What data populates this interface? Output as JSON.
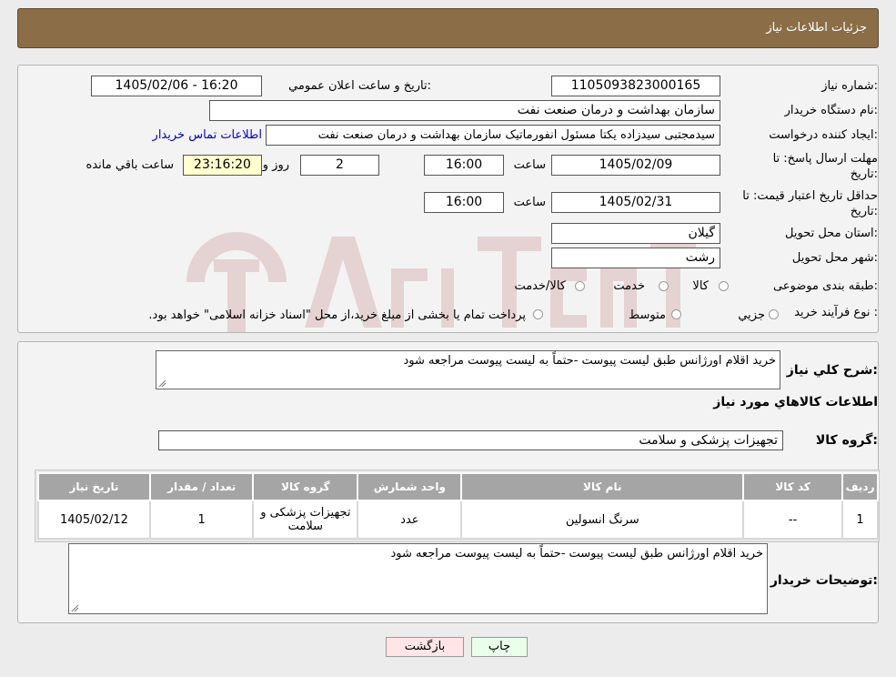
{
  "header": {
    "title": "جزئیات اطلاعات نیاز"
  },
  "form": {
    "need_number_label": "شماره نیاز:",
    "need_number": "1105093823000165",
    "announce_label": "تاریخ و ساعت اعلان عمومي:",
    "announce_value": "1405/02/06 - 16:20",
    "buyer_org_label": "نام دستگاه خریدار:",
    "buyer_org": "سازمان بهداشت و درمان صنعت نفت",
    "creator_label": "ایجاد کننده درخواست:",
    "creator": "سیدمجتبی سیدزاده یکتا مسئول انفورماتیک سازمان بهداشت و درمان صنعت نفت",
    "contact_link": "اطلاعات تماس خریدار",
    "deadline_label_1": "مهلت ارسال پاسخ: تا",
    "deadline_label_2": "تاریخ:",
    "deadline_date": "1405/02/09",
    "time_label": "ساعت",
    "deadline_time": "16:00",
    "days_value": "2",
    "days_label": "روز و",
    "remaining_time": "23:16:20",
    "remaining_label": "ساعت باقي مانده",
    "validity_label_1": "حداقل تاریخ اعتبار قیمت: تا",
    "validity_label_2": "تاریخ:",
    "validity_date": "1405/02/31",
    "validity_time": "16:00",
    "province_label": "استان محل تحویل:",
    "province": "گیلان",
    "city_label": "شهر محل تحویل:",
    "city": "رشت",
    "category_label": "طبقه بندی موضوعی:",
    "category_options": [
      "کالا",
      "خدمت",
      "کالا/خدمت"
    ],
    "process_label": "نوع فرآیند خرید :",
    "process_options": [
      "جزيي",
      "متوسط"
    ],
    "payment_note": "پرداخت تمام یا بخشی از مبلغ خرید،از محل \"اسناد خزانه اسلامی\" خواهد بود."
  },
  "details": {
    "description_label": "شرح کلي نیاز:",
    "description": "خرید اقلام اورژانس طبق لیست پیوست -حتماً به لیست پیوست مراجعه شود",
    "goods_info_title": "اطلاعات کالاهاي مورد نیاز",
    "goods_group_label": "گروه کالا:",
    "goods_group": "تجهیزات پزشکی و سلامت",
    "table": {
      "headers": [
        "ردیف",
        "کد کالا",
        "نام کالا",
        "واحد شمارش",
        "گروه کالا",
        "تعداد / مقدار",
        "تاریخ نیاز"
      ],
      "rows": [
        [
          "1",
          "--",
          "سرنگ انسولین",
          "عدد",
          "تجهیزات پزشکی و سلامت",
          "1",
          "1405/02/12"
        ]
      ]
    },
    "buyer_notes_label": "توضیحات خریدار:",
    "buyer_notes": "خرید اقلام اورژانس طبق لیست پیوست -حتماً به لیست پیوست مراجعه شود"
  },
  "buttons": {
    "print": "چاپ",
    "back": "بازگشت"
  },
  "colors": {
    "header_bg": "#8b6e47",
    "link": "#0000cc",
    "print_bg": "#eaffea",
    "back_bg": "#ffe5e5"
  }
}
